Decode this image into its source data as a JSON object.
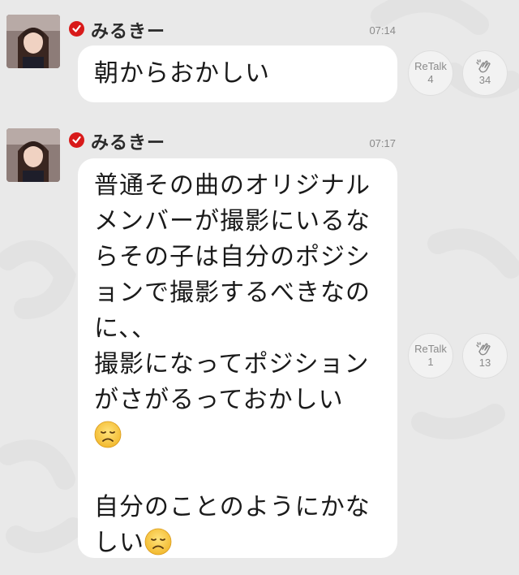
{
  "posts": [
    {
      "username": "みるきー",
      "time": "07:14",
      "lines": [
        "朝からおかしい"
      ],
      "retalk_label": "ReTalk",
      "retalk_count": "4",
      "clap_count": "34"
    },
    {
      "username": "みるきー",
      "time": "07:17",
      "lines": [
        "普通その曲のオリジナル",
        "メンバーが撮影にいるな",
        "らその子は自分のポジシ",
        "ョンで撮影するべきなの",
        "に、、",
        "撮影になってポジション",
        "がさがるっておかしい",
        "",
        "",
        "自分のことのようにかな",
        "しい"
      ],
      "retalk_label": "ReTalk",
      "retalk_count": "1",
      "clap_count": "13"
    }
  ],
  "icons": {
    "verified": "verified-check-icon",
    "clap": "clap-hands-icon",
    "emoji": "disappointed-face-emoji"
  },
  "colors": {
    "background": "#e9e9e9",
    "bubble": "#ffffff",
    "verified_badge": "#d81a1a",
    "meta_text": "#8a8a8a"
  }
}
